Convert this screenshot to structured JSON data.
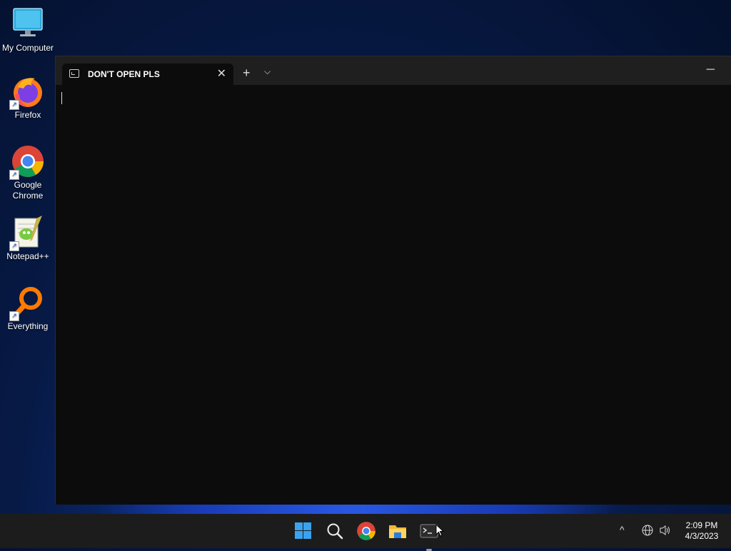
{
  "desktop": {
    "icons": [
      {
        "label": "My Computer",
        "icon": "monitor-icon"
      },
      {
        "label": "Firefox",
        "icon": "firefox-icon"
      },
      {
        "label": "Google Chrome",
        "icon": "chrome-icon"
      },
      {
        "label": "Notepad++",
        "icon": "notepadpp-icon"
      },
      {
        "label": "Everything",
        "icon": "everything-icon"
      }
    ]
  },
  "terminal": {
    "tab_title": "DON'T OPEN PLS",
    "tab_close": "✕",
    "new_tab": "+",
    "dropdown": "⌵",
    "minimize": "─"
  },
  "taskbar": {
    "apps": [
      "start-icon",
      "search-icon",
      "chrome-icon",
      "file-explorer-icon",
      "terminal-icon"
    ],
    "tray_chevron": "^",
    "time": "2:09 PM",
    "date": "4/3/2023"
  },
  "colors": {
    "terminal_bg": "#0c0c0c",
    "titlebar_bg": "#1f1f1f",
    "taskbar_bg": "#1c1c1c",
    "start_blue": "#3aa3ef"
  }
}
